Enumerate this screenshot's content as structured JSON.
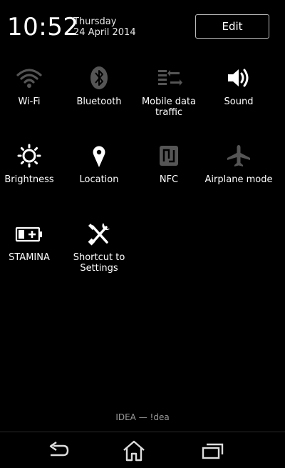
{
  "status": {
    "time": "10:52",
    "day": "Thursday",
    "date": "24 April 2014",
    "edit_label": "Edit"
  },
  "tiles": [
    {
      "label": "Wi-Fi",
      "icon": "wifi-icon",
      "state": "off"
    },
    {
      "label": "Bluetooth",
      "icon": "bluetooth-icon",
      "state": "off"
    },
    {
      "label": "Mobile data traffic",
      "icon": "mobile-data-icon",
      "state": "off"
    },
    {
      "label": "Sound",
      "icon": "sound-icon",
      "state": "on"
    },
    {
      "label": "Brightness",
      "icon": "brightness-icon",
      "state": "on"
    },
    {
      "label": "Location",
      "icon": "location-icon",
      "state": "on"
    },
    {
      "label": "NFC",
      "icon": "nfc-icon",
      "state": "off"
    },
    {
      "label": "Airplane mode",
      "icon": "airplane-icon",
      "state": "off"
    },
    {
      "label": "STAMINA",
      "icon": "battery-stamina-icon",
      "state": "on"
    },
    {
      "label": "Shortcut to Settings",
      "icon": "settings-tools-icon",
      "state": "on"
    }
  ],
  "carrier": "IDEA — !dea",
  "navigation": {
    "back_icon": "back-icon",
    "home_icon": "home-icon",
    "recents_icon": "recents-icon"
  },
  "colors": {
    "background": "#000000",
    "icon_on": "#ffffff",
    "icon_off": "#555555",
    "text": "#ffffff",
    "carrier_text": "#9a9a9a"
  }
}
